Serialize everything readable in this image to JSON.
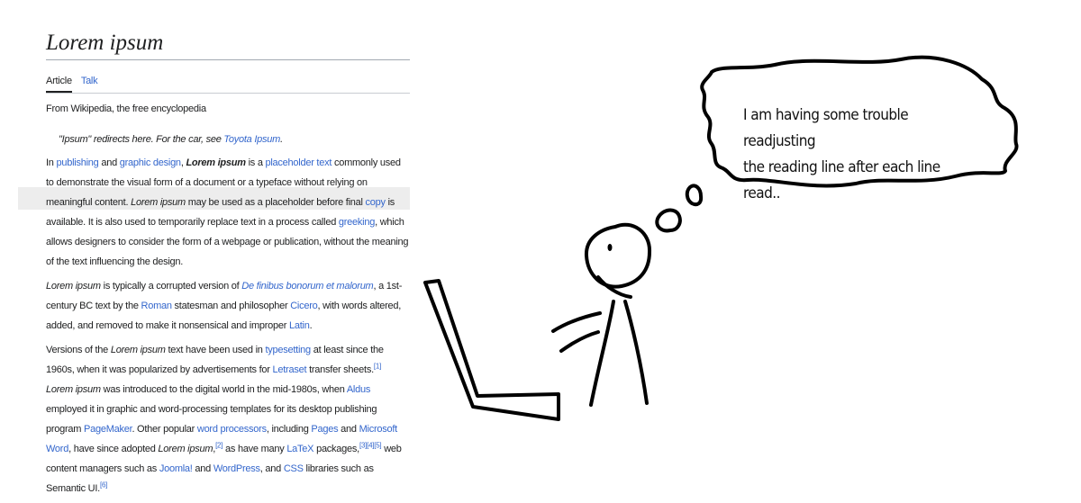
{
  "article": {
    "title": "Lorem ipsum",
    "tabs": [
      {
        "label": "Article",
        "active": true
      },
      {
        "label": "Talk",
        "active": false
      }
    ],
    "tagline": "From Wikipedia, the free encyclopedia",
    "hatnote": {
      "text": "\"Ipsum\" redirects here. For the car, see ",
      "link": "Toyota Ipsum",
      "end": "."
    },
    "p1": {
      "t0": "In ",
      "l_publishing": "publishing",
      "t1": " and ",
      "l_graphic": "graphic design",
      "t2": ", ",
      "b_lorem": "Lorem ipsum",
      "t3": " is a ",
      "l_placeholder": "placeholder text",
      "t4": " commonly used to demonstrate the visual form of a document or a typeface without relying on meaningful content. ",
      "i_lorem": "Lorem ipsum",
      "t5": " may be used as a placeholder before final ",
      "l_copy": "copy",
      "t6": " is available. It is also used to temporarily replace text in a process called ",
      "l_greeking": "greeking",
      "t7": ", which allows designers to consider the form of a webpage or publication, without the meaning of the text influencing the design."
    },
    "p2": {
      "i_lorem": "Lorem ipsum",
      "t0": " is typically a corrupted version of ",
      "l_definibus": "De finibus bonorum et malorum",
      "t1": ", a 1st-century BC text by the ",
      "l_roman": "Roman",
      "t2": " statesman and philosopher ",
      "l_cicero": "Cicero",
      "t3": ", with words altered, added, and removed to make it nonsensical and improper ",
      "l_latin": "Latin",
      "t4": "."
    },
    "p3": {
      "t0": "Versions of the ",
      "i_lorem1": "Lorem ipsum",
      "t1": " text have been used in ",
      "l_typesetting": "typesetting",
      "t2": " at least since the 1960s, when it was popularized by advertisements for ",
      "l_letraset": "Letraset",
      "t3": " transfer sheets.",
      "ref1": "[1]",
      "t3b": " ",
      "i_lorem2": "Lorem ipsum",
      "t4": " was introduced to the digital world in the mid-1980s, when ",
      "l_aldus": "Aldus",
      "t5": " employed it in graphic and word-processing templates for its desktop publishing program ",
      "l_pagemaker": "PageMaker",
      "t6": ". Other popular ",
      "l_wordproc": "word processors",
      "t7": ", including ",
      "l_pages": "Pages",
      "t8": " and ",
      "l_msword": "Microsoft Word",
      "t9": ", have since adopted ",
      "i_lorem3": "Lorem ipsum",
      "t10": ",",
      "ref2": "[2]",
      "t11": " as have many ",
      "l_latex": "LaTeX",
      "t12": " packages,",
      "ref345": "[3][4][5]",
      "t13": " web content managers such as ",
      "l_joomla": "Joomla!",
      "t14": " and ",
      "l_wordpress": "WordPress",
      "t15": ", and ",
      "l_css": "CSS",
      "t16": " libraries such as Semantic UI.",
      "ref6": "[6]"
    }
  },
  "thought": {
    "line1": "I am having some trouble readjusting",
    "line2": "the reading line after each line read.."
  },
  "colors": {
    "link": "#3366cc",
    "text": "#202122",
    "ink": "#000000"
  },
  "icons": [
    "stick-figure",
    "laptop",
    "thought-bubble"
  ]
}
